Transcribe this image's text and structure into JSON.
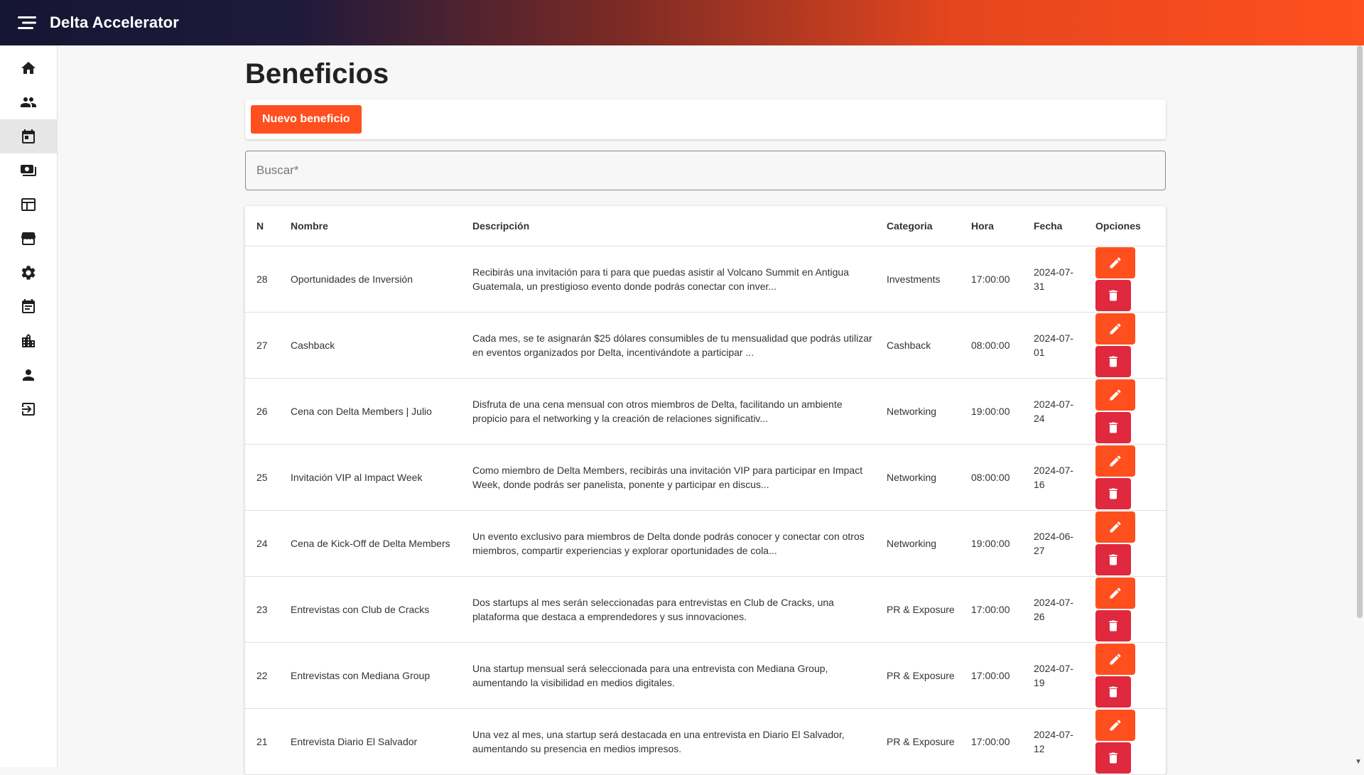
{
  "app": {
    "title": "Delta Accelerator"
  },
  "sidebar": {
    "items": [
      {
        "icon": "home-icon"
      },
      {
        "icon": "people-icon"
      },
      {
        "icon": "calendar-today-icon",
        "active": true
      },
      {
        "icon": "payments-icon"
      },
      {
        "icon": "table-icon"
      },
      {
        "icon": "storefront-icon"
      },
      {
        "icon": "gear-icon"
      },
      {
        "icon": "event-note-icon"
      },
      {
        "icon": "business-icon"
      },
      {
        "icon": "person-icon"
      },
      {
        "icon": "login-icon"
      }
    ]
  },
  "page": {
    "title": "Beneficios",
    "new_button": "Nuevo beneficio",
    "search_placeholder": "Buscar*"
  },
  "colors": {
    "accent": "#ff4f1f",
    "danger": "#e0283e"
  },
  "table": {
    "headers": {
      "n": "N",
      "nombre": "Nombre",
      "descripcion": "Descripción",
      "categoria": "Categoria",
      "hora": "Hora",
      "fecha": "Fecha",
      "opciones": "Opciones"
    },
    "rows": [
      {
        "n": "28",
        "nombre": "Oportunidades de Inversión",
        "descripcion": "Recibirás una invitación para ti para que puedas asistir al Volcano Summit en Antigua Guatemala, un prestigioso evento donde podrás conectar con inver...",
        "categoria": "Investments",
        "hora": "17:00:00",
        "fecha": "2024-07-31"
      },
      {
        "n": "27",
        "nombre": "Cashback",
        "descripcion": "Cada mes, se te asignarán $25 dólares consumibles de tu mensualidad que podrás utilizar en eventos organizados por Delta, incentivándote a participar ...",
        "categoria": "Cashback",
        "hora": "08:00:00",
        "fecha": "2024-07-01"
      },
      {
        "n": "26",
        "nombre": "Cena con Delta Members | Julio",
        "descripcion": "Disfruta de una cena mensual con otros miembros de Delta, facilitando un ambiente propicio para el networking y la creación de relaciones significativ...",
        "categoria": "Networking",
        "hora": "19:00:00",
        "fecha": "2024-07-24"
      },
      {
        "n": "25",
        "nombre": "Invitación VIP al Impact Week",
        "descripcion": "Como miembro de Delta Members, recibirás una invitación VIP para participar en Impact Week, donde podrás ser panelista, ponente y participar en discus...",
        "categoria": "Networking",
        "hora": "08:00:00",
        "fecha": "2024-07-16"
      },
      {
        "n": "24",
        "nombre": "Cena de Kick-Off de Delta Members",
        "descripcion": "Un evento exclusivo para miembros de Delta donde podrás conocer y conectar con otros miembros, compartir experiencias y explorar oportunidades de cola...",
        "categoria": "Networking",
        "hora": "19:00:00",
        "fecha": "2024-06-27"
      },
      {
        "n": "23",
        "nombre": "Entrevistas con Club de Cracks",
        "descripcion": "Dos startups al mes serán seleccionadas para entrevistas en Club de Cracks, una plataforma que destaca a emprendedores y sus innovaciones.",
        "categoria": "PR & Exposure",
        "hora": "17:00:00",
        "fecha": "2024-07-26"
      },
      {
        "n": "22",
        "nombre": "Entrevistas con Mediana Group",
        "descripcion": "Una startup mensual será seleccionada para una entrevista con Mediana Group, aumentando la visibilidad en medios digitales.",
        "categoria": "PR & Exposure",
        "hora": "17:00:00",
        "fecha": "2024-07-19"
      },
      {
        "n": "21",
        "nombre": "Entrevista Diario El Salvador",
        "descripcion": "Una vez al mes, una startup será destacada en una entrevista en Diario El Salvador, aumentando su presencia en medios impresos.",
        "categoria": "PR & Exposure",
        "hora": "17:00:00",
        "fecha": "2024-07-12"
      }
    ]
  }
}
